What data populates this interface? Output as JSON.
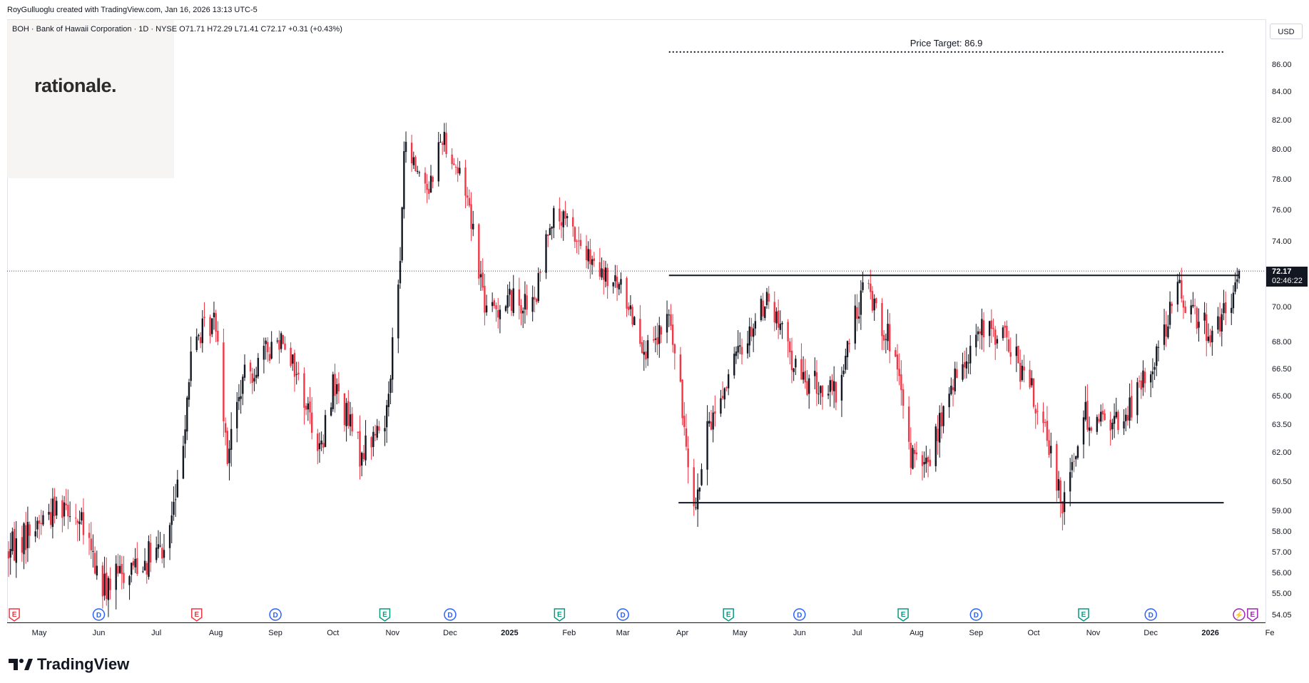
{
  "header": {
    "credit": "RoyGulluoglu created with TradingView.com, Jan 16, 2026 13:13 UTC-5",
    "symbol_line": "BOH · Bank of Hawaii Corporation · 1D · NYSE  O71.71  H72.29  L71.41  C72.17  +0.31 (+0.43%)"
  },
  "logo": {
    "text": "rationale."
  },
  "price_axis": {
    "currency": "USD",
    "ticks": [
      "86.00",
      "84.00",
      "82.00",
      "80.00",
      "78.00",
      "76.00",
      "74.00",
      "72.17",
      "70.00",
      "68.00",
      "66.50",
      "65.00",
      "63.50",
      "62.00",
      "60.50",
      "59.00",
      "58.00",
      "57.00",
      "56.00",
      "55.00",
      "54.05"
    ],
    "last_price": "72.17",
    "countdown": "02:46:22"
  },
  "time_axis": {
    "labels": [
      "May",
      "Jun",
      "Jul",
      "Aug",
      "Sep",
      "Oct",
      "Nov",
      "Dec",
      "2025",
      "Feb",
      "Mar",
      "Apr",
      "May",
      "Jun",
      "Jul",
      "Aug",
      "Sep",
      "Oct",
      "Nov",
      "Dec",
      "2026",
      "Fe"
    ]
  },
  "annotations": {
    "price_target": "Price Target: 86.9"
  },
  "events": {
    "types": [
      "E",
      "D",
      "E",
      "D",
      "E",
      "D",
      "E",
      "D",
      "E",
      "D",
      "E",
      "D",
      "E",
      "D",
      "E",
      "D",
      "⚡",
      "E"
    ]
  },
  "brand": {
    "name": "TradingView"
  },
  "colors": {
    "up": "#131722",
    "down": "#f23645",
    "earnings_red": "#f23645",
    "earnings_green": "#089981",
    "dividend": "#2962ff",
    "split": "#9c27b0"
  },
  "chart_data": {
    "type": "candlestick",
    "title": "BOH · Bank of Hawaii Corporation · 1D · NYSE",
    "x_start": "2024-04-15",
    "x_end": "2026-01-16",
    "ylim": [
      54.05,
      87.5
    ],
    "y_scale": "log",
    "last_price": 72.17,
    "ohlc_last": {
      "open": 71.71,
      "high": 72.29,
      "low": 71.41,
      "close": 72.17,
      "change": 0.31,
      "change_pct": 0.43
    },
    "price_path": [
      [
        "2024-04-15",
        57.0
      ],
      [
        "2024-05-01",
        58.5
      ],
      [
        "2024-05-15",
        59.6
      ],
      [
        "2024-05-25",
        57.8
      ],
      [
        "2024-06-03",
        55.2
      ],
      [
        "2024-06-20",
        56.5
      ],
      [
        "2024-07-05",
        57.0
      ],
      [
        "2024-07-12",
        60.0
      ],
      [
        "2024-07-20",
        68.0
      ],
      [
        "2024-08-01",
        69.3
      ],
      [
        "2024-08-07",
        62.0
      ],
      [
        "2024-08-15",
        65.8
      ],
      [
        "2024-09-05",
        68.5
      ],
      [
        "2024-09-25",
        62.0
      ],
      [
        "2024-10-01",
        65.8
      ],
      [
        "2024-10-15",
        62.0
      ],
      [
        "2024-10-28",
        63.5
      ],
      [
        "2024-11-01",
        67.8
      ],
      [
        "2024-11-05",
        72.5
      ],
      [
        "2024-11-07",
        80.0
      ],
      [
        "2024-11-20",
        77.5
      ],
      [
        "2024-11-27",
        81.0
      ],
      [
        "2024-12-10",
        77.0
      ],
      [
        "2024-12-20",
        69.5
      ],
      [
        "2025-01-01",
        70.5
      ],
      [
        "2025-01-14",
        70.0
      ],
      [
        "2025-01-22",
        75.5
      ],
      [
        "2025-02-01",
        75.0
      ],
      [
        "2025-02-15",
        72.0
      ],
      [
        "2025-03-01",
        71.0
      ],
      [
        "2025-03-15",
        67.0
      ],
      [
        "2025-03-25",
        69.5
      ],
      [
        "2025-04-04",
        62.0
      ],
      [
        "2025-04-08",
        59.2
      ],
      [
        "2025-04-15",
        63.5
      ],
      [
        "2025-05-01",
        67.5
      ],
      [
        "2025-05-15",
        70.5
      ],
      [
        "2025-06-01",
        66.0
      ],
      [
        "2025-06-20",
        65.0
      ],
      [
        "2025-07-05",
        71.5
      ],
      [
        "2025-07-20",
        67.5
      ],
      [
        "2025-07-28",
        62.0
      ],
      [
        "2025-08-05",
        61.0
      ],
      [
        "2025-08-20",
        65.5
      ],
      [
        "2025-09-01",
        68.5
      ],
      [
        "2025-09-15",
        68.5
      ],
      [
        "2025-10-01",
        65.0
      ],
      [
        "2025-10-16",
        59.6
      ],
      [
        "2025-10-28",
        64.0
      ],
      [
        "2025-11-15",
        63.5
      ],
      [
        "2025-12-01",
        66.5
      ],
      [
        "2025-12-15",
        71.0
      ],
      [
        "2026-01-01",
        68.5
      ],
      [
        "2026-01-12",
        70.0
      ],
      [
        "2026-01-16",
        72.17
      ]
    ],
    "levels": [
      {
        "name": "resistance",
        "y": 71.9,
        "x_from": "2025-03-25",
        "x_to": "2026-01-16"
      },
      {
        "name": "support",
        "y": 59.4,
        "x_from": "2025-03-30",
        "x_to": "2026-01-08"
      },
      {
        "name": "price_target",
        "y": 86.9,
        "x_from": "2025-03-25",
        "x_to": "2026-01-08",
        "style": "dotted"
      }
    ],
    "event_dates": [
      "2024-04-18",
      "2024-06-01",
      "2024-07-22",
      "2024-09-01",
      "2024-10-28",
      "2024-12-01",
      "2025-01-27",
      "2025-03-01",
      "2025-04-25",
      "2025-06-01",
      "2025-07-25",
      "2025-09-01",
      "2025-10-27",
      "2025-12-01",
      "2026-01-16",
      "2026-01-23"
    ],
    "grid": false,
    "legend": "none"
  }
}
